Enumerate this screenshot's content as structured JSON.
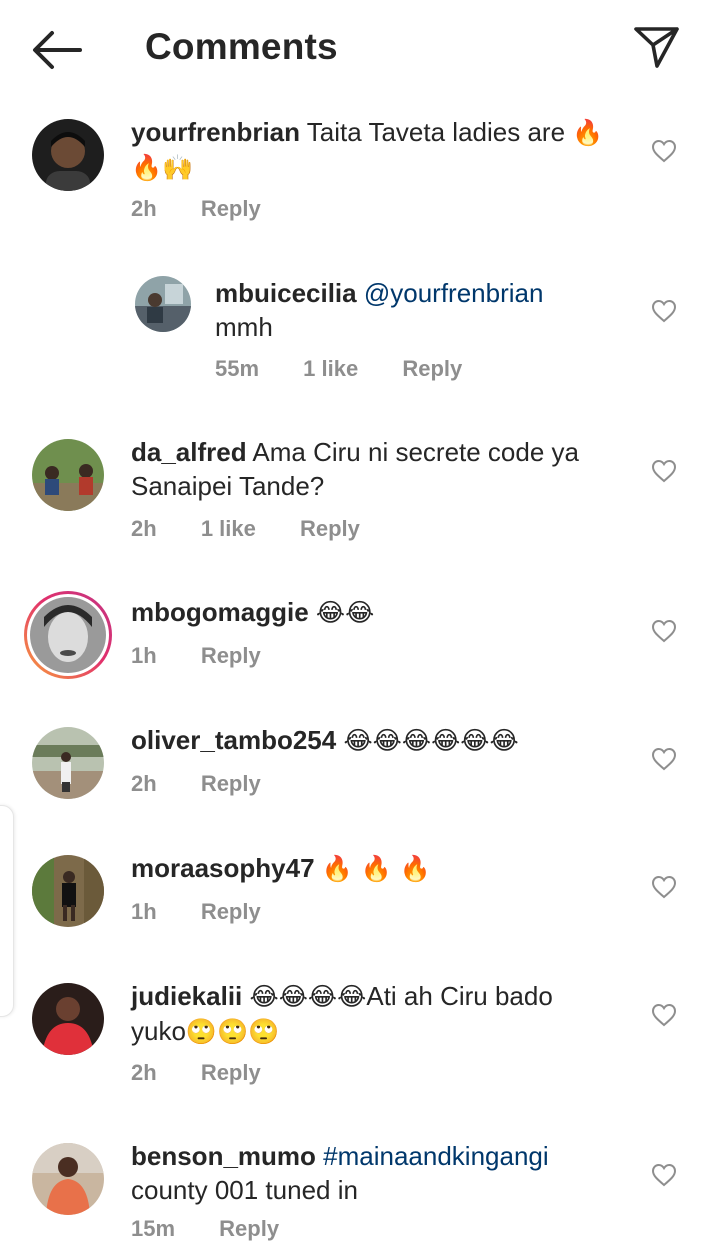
{
  "header": {
    "title": "Comments"
  },
  "comments": [
    {
      "username": "yourfrenbrian",
      "text": "Taita Taveta ladies are",
      "emoji_line1": "🔥",
      "emoji_line2": "🔥🙌",
      "time": "2h",
      "reply": "Reply"
    },
    {
      "username": "mbuicecilia",
      "mention": "@yourfrenbrian",
      "text": "mmh",
      "time": "55m",
      "likes": "1 like",
      "reply": "Reply"
    },
    {
      "username": "da_alfred",
      "text": "Ama Ciru ni secrete code ya",
      "text2": "Sanaipei Tande?",
      "time": "2h",
      "likes": "1 like",
      "reply": "Reply"
    },
    {
      "username": "mbogomaggie",
      "emoji": "😂😂",
      "time": "1h",
      "reply": "Reply"
    },
    {
      "username": "oliver_tambo254",
      "emoji": "😂😂😂😂😂😂",
      "time": "2h",
      "reply": "Reply"
    },
    {
      "username": "moraasophy47",
      "emoji": "🔥 🔥 🔥",
      "time": "1h",
      "reply": "Reply"
    },
    {
      "username": "judiekalii",
      "emoji": "😂😂😂😂",
      "text": "Ati ah Ciru bado",
      "text2": "yuko",
      "emoji2": "🙄🙄🙄",
      "time": "2h",
      "reply": "Reply"
    },
    {
      "username": "benson_mumo",
      "hashtag": "#mainaandkingangi",
      "text": "county 001 tuned in",
      "time": "15m",
      "reply": "Reply"
    }
  ],
  "icons": {
    "back": "arrow-left-icon",
    "send": "paper-plane-icon",
    "like": "heart-outline-icon"
  },
  "colors": {
    "text": "#262626",
    "meta": "#8e8e8e",
    "mention": "#00376b",
    "story_ring_start": "#f9a23c",
    "story_ring_end": "#c13584"
  }
}
